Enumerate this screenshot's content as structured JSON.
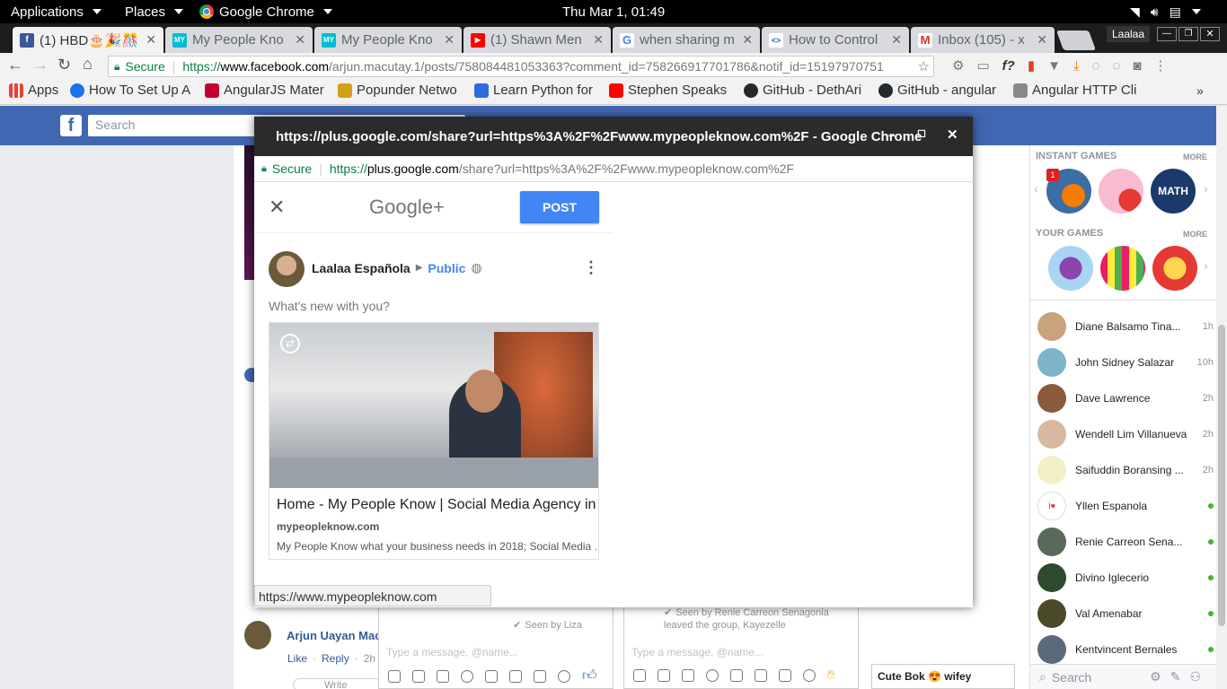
{
  "topbar": {
    "applications": "Applications",
    "places": "Places",
    "browser": "Google Chrome",
    "datetime": "Thu Mar  1, 01:49"
  },
  "tabs": [
    {
      "title": "(1) HBD🎂🎉🎊",
      "favicon_color": "#3b5998",
      "favicon": "f"
    },
    {
      "title": "My People Kno",
      "favicon_color": "#00bcd4",
      "favicon": "MY"
    },
    {
      "title": "My People Kno",
      "favicon_color": "#00bcd4",
      "favicon": "MY"
    },
    {
      "title": "(1) Shawn Men",
      "favicon_color": "#ff0000",
      "favicon": "▶"
    },
    {
      "title": "when sharing m",
      "favicon_color": "#4285f4",
      "favicon": "G"
    },
    {
      "title": "How to Control",
      "favicon_color": "#1565c0",
      "favicon": "<>"
    },
    {
      "title": "Inbox (105) - x",
      "favicon_color": "#d93025",
      "favicon": "M"
    }
  ],
  "profile_name": "Laalaa",
  "omnibox": {
    "secure_label": "Secure",
    "url_scheme": "https://",
    "url_host": "www.facebook.com",
    "url_path": "/arjun.macutay.1/posts/758084481053363?comment_id=758266917701786&notif_id=15197970751"
  },
  "bookmarks": [
    {
      "label": "Apps",
      "color": "#e94235"
    },
    {
      "label": "How To Set Up A",
      "color": "#1a73e8"
    },
    {
      "label": "AngularJS Mater",
      "color": "#c3002f"
    },
    {
      "label": "Popunder Netwo",
      "color": "#d4a017"
    },
    {
      "label": "Learn Python for",
      "color": "#2d6cdf"
    },
    {
      "label": "Stephen Speaks",
      "color": "#ff0000"
    },
    {
      "label": "GitHub - DethAri",
      "color": "#24292e"
    },
    {
      "label": "GitHub - angular",
      "color": "#24292e"
    },
    {
      "label": "Angular HTTP Cli",
      "color": "#888888"
    }
  ],
  "facebook": {
    "search_placeholder": "Search",
    "comment_author": "Arjun Uayan Mac",
    "comment_actions": {
      "like": "Like",
      "reply": "Reply",
      "time": "2h"
    },
    "write_reply": "Write a re"
  },
  "popup": {
    "window_title": "https://plus.google.com/share?url=https%3A%2F%2Fwww.mypeopleknow.com%2F - Google Chrome",
    "secure_label": "Secure",
    "url_scheme": "https://",
    "url_host": "plus.google.com",
    "url_path": "/share?url=https%3A%2F%2Fwww.mypeopleknow.com%2F",
    "logo": "Google+",
    "post_label": "POST",
    "user_name": "Laalaa Española",
    "audience": "Public",
    "prompt": "What's new with you?",
    "link_title": "Home - My People Know | Social Media Agency in...",
    "link_domain": "mypeopleknow.com",
    "link_desc": "My People Know what your business needs in 2018; Social Media ..."
  },
  "status_url": "https://www.mypeopleknow.com",
  "right_sidebar": {
    "instant_games_header": "INSTANT GAMES",
    "your_games_header": "YOUR GAMES",
    "more_label": "MORE",
    "game_badge": "1",
    "contacts": [
      {
        "name": "Diane Balsamo Tina...",
        "time": "1h",
        "online": false
      },
      {
        "name": "John Sidney Salazar",
        "time": "10h",
        "online": false
      },
      {
        "name": "Dave Lawrence",
        "time": "2h",
        "online": false
      },
      {
        "name": "Wendell Lim Villanueva",
        "time": "2h",
        "online": false
      },
      {
        "name": "Saifuddin Boransing ...",
        "time": "2h",
        "online": false
      },
      {
        "name": "Yllen Espanola",
        "time": "",
        "online": true
      },
      {
        "name": "Renie Carreon Sena...",
        "time": "",
        "online": true
      },
      {
        "name": "Divino Iglecerio",
        "time": "",
        "online": true
      },
      {
        "name": "Val Amenabar",
        "time": "",
        "online": true
      },
      {
        "name": "Kentvincent Bernales",
        "time": "",
        "online": true
      }
    ],
    "search_placeholder": "Search"
  },
  "chats": [
    {
      "seen": "Seen by Liza",
      "placeholder": "Type a message, @name..."
    },
    {
      "seen": "Seen by Renie Carreon Senagonia",
      "event": "leaved the group, Kayezelle",
      "placeholder": "Type a message, @name..."
    }
  ],
  "chat_tab": {
    "name": "Cute Bok 😍 wifey"
  }
}
